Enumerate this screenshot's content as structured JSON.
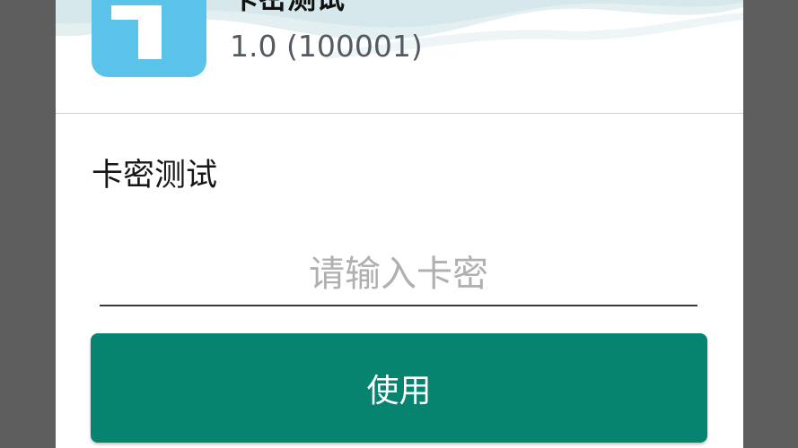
{
  "dialog": {
    "app_name": "卡密测试",
    "app_version": "1.0 (100001)",
    "app_icon": "app-logo-icon",
    "section_label": "卡密测试",
    "input": {
      "value": "",
      "placeholder": "请输入卡密"
    },
    "use_button_label": "使用"
  },
  "colors": {
    "scrim": "#5e5e5e",
    "dialog_bg": "#ffffff",
    "icon_bg": "#5bc3ea",
    "button_bg": "#068470",
    "button_text": "#ffffff",
    "placeholder": "#b0b0b0"
  }
}
